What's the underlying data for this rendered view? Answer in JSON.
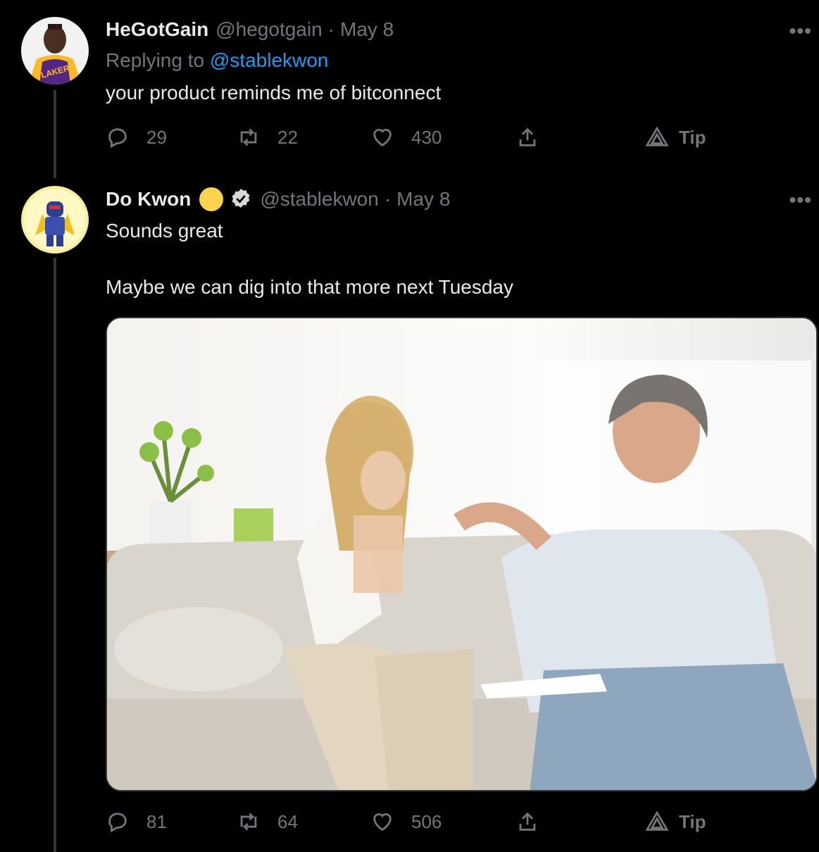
{
  "tweets": [
    {
      "name": "HeGotGain",
      "handle": "@hegotgain",
      "separator": "·",
      "date": "May 8",
      "replying_prefix": "Replying to",
      "replying_to": "@stablekwon",
      "text": "your product reminds me of bitconnect",
      "more": "•••",
      "counts": {
        "replies": "29",
        "retweets": "22",
        "likes": "430"
      },
      "tip_label": "Tip"
    },
    {
      "name": "Do Kwon",
      "handle": "@stablekwon",
      "separator": "·",
      "date": "May 8",
      "text_line1": "Sounds great",
      "text_line2": "Maybe we can dig into that more next Tuesday",
      "more": "•••",
      "counts": {
        "replies": "81",
        "retweets": "64",
        "likes": "506"
      },
      "tip_label": "Tip"
    }
  ],
  "icons": {
    "reply": "reply-icon",
    "retweet": "retweet-icon",
    "like": "heart-icon",
    "share": "share-icon",
    "tip": "tip-icon",
    "verified": "verified-badge-icon"
  },
  "colors": {
    "background": "#000000",
    "link": "#1d9bf0",
    "muted": "#71767b",
    "text": "#e7e9ea"
  }
}
